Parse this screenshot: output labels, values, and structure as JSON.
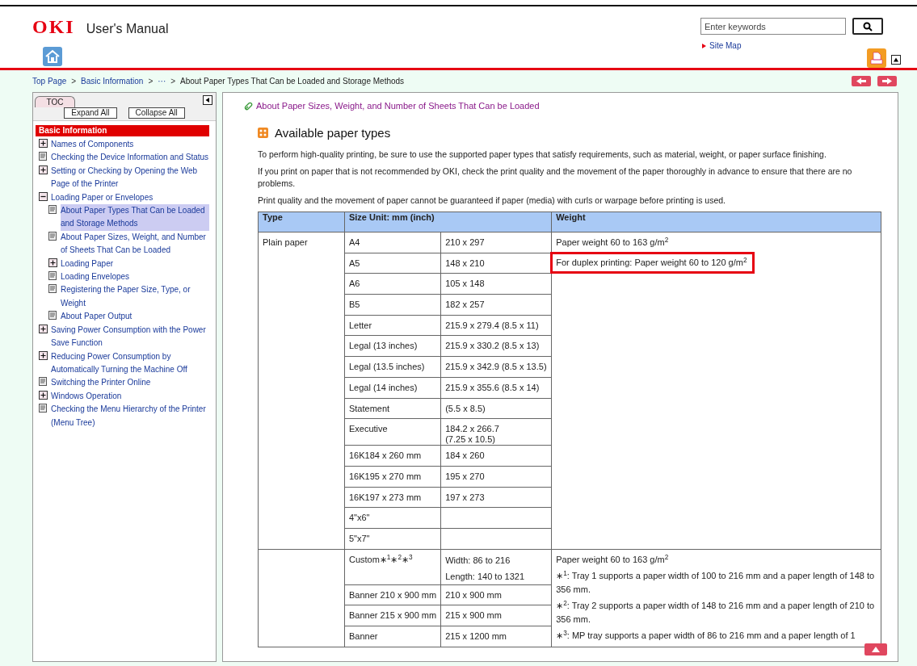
{
  "header": {
    "logo": "OKI",
    "title": "User's Manual",
    "search": {
      "placeholder": "Enter keywords"
    },
    "site_map": "Site Map"
  },
  "breadcrumb": [
    {
      "label": "Top Page"
    },
    {
      "separator": ">",
      "label": "Basic Information"
    },
    {
      "separator": ">",
      "label": "···"
    },
    {
      "separator": ">",
      "label": "About Paper Types That Can be Loaded and Storage Methods"
    }
  ],
  "toc": {
    "tab": "TOC",
    "buttons": [
      "Expand All",
      "Collapse All"
    ],
    "section": "Basic Information",
    "items": [
      {
        "kind": "folder",
        "label": "Names of Components",
        "expanded": false,
        "selected": false
      },
      {
        "kind": "page",
        "label": "Checking the Device Information and Status",
        "selected": false
      },
      {
        "kind": "folder",
        "label": "Setting or Checking by Opening the Web Page of the Printer",
        "expanded": false,
        "selected": false
      },
      {
        "kind": "folder",
        "label": "Loading Paper or Envelopes",
        "expanded": true,
        "selected": false,
        "children": [
          {
            "kind": "page",
            "label": "About Paper Types That Can be Loaded and Storage Methods",
            "selected": true
          },
          {
            "kind": "page",
            "label": "About Paper Sizes, Weight, and Number of Sheets That Can be Loaded",
            "selected": false
          },
          {
            "kind": "folder",
            "label": "Loading Paper",
            "expanded": false,
            "selected": false
          },
          {
            "kind": "page",
            "label": "Loading Envelopes",
            "selected": false
          },
          {
            "kind": "page",
            "label": "Registering the Paper Size, Type, or Weight",
            "selected": false
          },
          {
            "kind": "page",
            "label": "About Paper Output",
            "selected": false
          }
        ]
      },
      {
        "kind": "folder",
        "label": "Saving Power Consumption with the Power Save Function",
        "expanded": false,
        "selected": false
      },
      {
        "kind": "folder",
        "label": "Reducing Power Consumption by Automatically Turning the Machine Off",
        "expanded": false,
        "selected": false
      },
      {
        "kind": "page",
        "label": "Switching the Printer Online",
        "selected": false
      },
      {
        "kind": "folder",
        "label": "Windows Operation",
        "expanded": false,
        "selected": false
      },
      {
        "kind": "page",
        "label": "Checking the Menu Hierarchy of the Printer (Menu Tree)",
        "selected": false
      }
    ]
  },
  "content": {
    "link": "About Paper Sizes, Weight, and Number of Sheets That Can be Loaded",
    "heading": "Available paper types",
    "paragraphs": [
      "To perform high-quality printing, be sure to use the supported paper types that satisfy requirements, such as material, weight, or paper surface finishing.",
      "If you print on paper that is not recommended by OKI, check the print quality and the movement of the paper thoroughly in advance to ensure that there are no problems.",
      "Print quality and the movement of paper cannot be guaranteed if paper (media) with curls or warpage before printing is used."
    ],
    "table": {
      "columns": [
        "Type",
        "Size Unit: mm (inch)",
        "Weight"
      ],
      "groups": [
        {
          "type": "Plain paper",
          "sizes": [
            {
              "name": "A4",
              "dims": [
                "210 x 297"
              ]
            },
            {
              "name": "A5",
              "dims": [
                "148 x 210"
              ]
            },
            {
              "name": "A6",
              "dims": [
                "105 x 148"
              ]
            },
            {
              "name": "B5",
              "dims": [
                "182 x 257"
              ]
            },
            {
              "name": "Letter",
              "dims": [
                "215.9 x 279.4 (8.5 x 11)"
              ]
            },
            {
              "name": "Legal (13 inches)",
              "dims": [
                "215.9 x 330.2 (8.5 x 13)"
              ]
            },
            {
              "name": "Legal (13.5 inches)",
              "dims": [
                "215.9 x 342.9 (8.5 x 13.5)"
              ]
            },
            {
              "name": "Legal (14 inches)",
              "dims": [
                "215.9 x 355.6 (8.5 x 14)"
              ]
            },
            {
              "name": "Statement",
              "dims": [
                "(5.5 x 8.5)"
              ]
            },
            {
              "name": "Executive",
              "dims": [
                "184.2 x 266.7",
                "(7.25 x 10.5)"
              ]
            },
            {
              "name": "16K184 x 260 mm",
              "dims": [
                "184 x 260"
              ]
            },
            {
              "name": "16K195 x 270 mm",
              "dims": [
                "195 x 270"
              ]
            },
            {
              "name": "16K197 x 273 mm",
              "dims": [
                "197 x 273"
              ]
            },
            {
              "name": "4\"x6\""
            },
            {
              "name": "5\"x7\""
            }
          ],
          "weight": [
            {
              "text": "Paper weight 60 to 163 g/m$^{2}$",
              "highlighted": false
            },
            {
              "text": "For duplex printing: Paper weight 60 to 120 g/m$^{2}$",
              "highlighted": true
            }
          ]
        },
        {
          "sizes": [
            {
              "name": "Custom∗$^{1}$∗$^{2}$∗$^{3}$",
              "dims": [
                "Width: 86 to 216",
                "Length: 140 to 1321"
              ]
            },
            {
              "name": "Banner 210 x 900 mm",
              "dims": [
                "210 x 900 mm"
              ]
            },
            {
              "name": "Banner 215 x 900 mm",
              "dims": [
                "215 x 900 mm"
              ]
            },
            {
              "name": "Banner",
              "dims": [
                "215 x 1200 mm"
              ]
            }
          ],
          "weight": [
            {
              "text": "Paper weight 60 to 163 g/m$^{2}$",
              "highlighted": false
            },
            {
              "text": "∗$^{1}$: Tray 1 supports a paper width of 100 to 216 mm and a paper length of 148 to 356 mm.",
              "highlighted": false
            },
            {
              "text": "∗$^{2}$: Tray 2 supports a paper width of 148 to 216 mm and a paper length of 210 to 356 mm.",
              "highlighted": false
            },
            {
              "text": "∗$^{3}$: MP tray supports a paper width of 86 to 216 mm and a paper length of 1",
              "highlighted": false
            }
          ]
        }
      ]
    }
  }
}
